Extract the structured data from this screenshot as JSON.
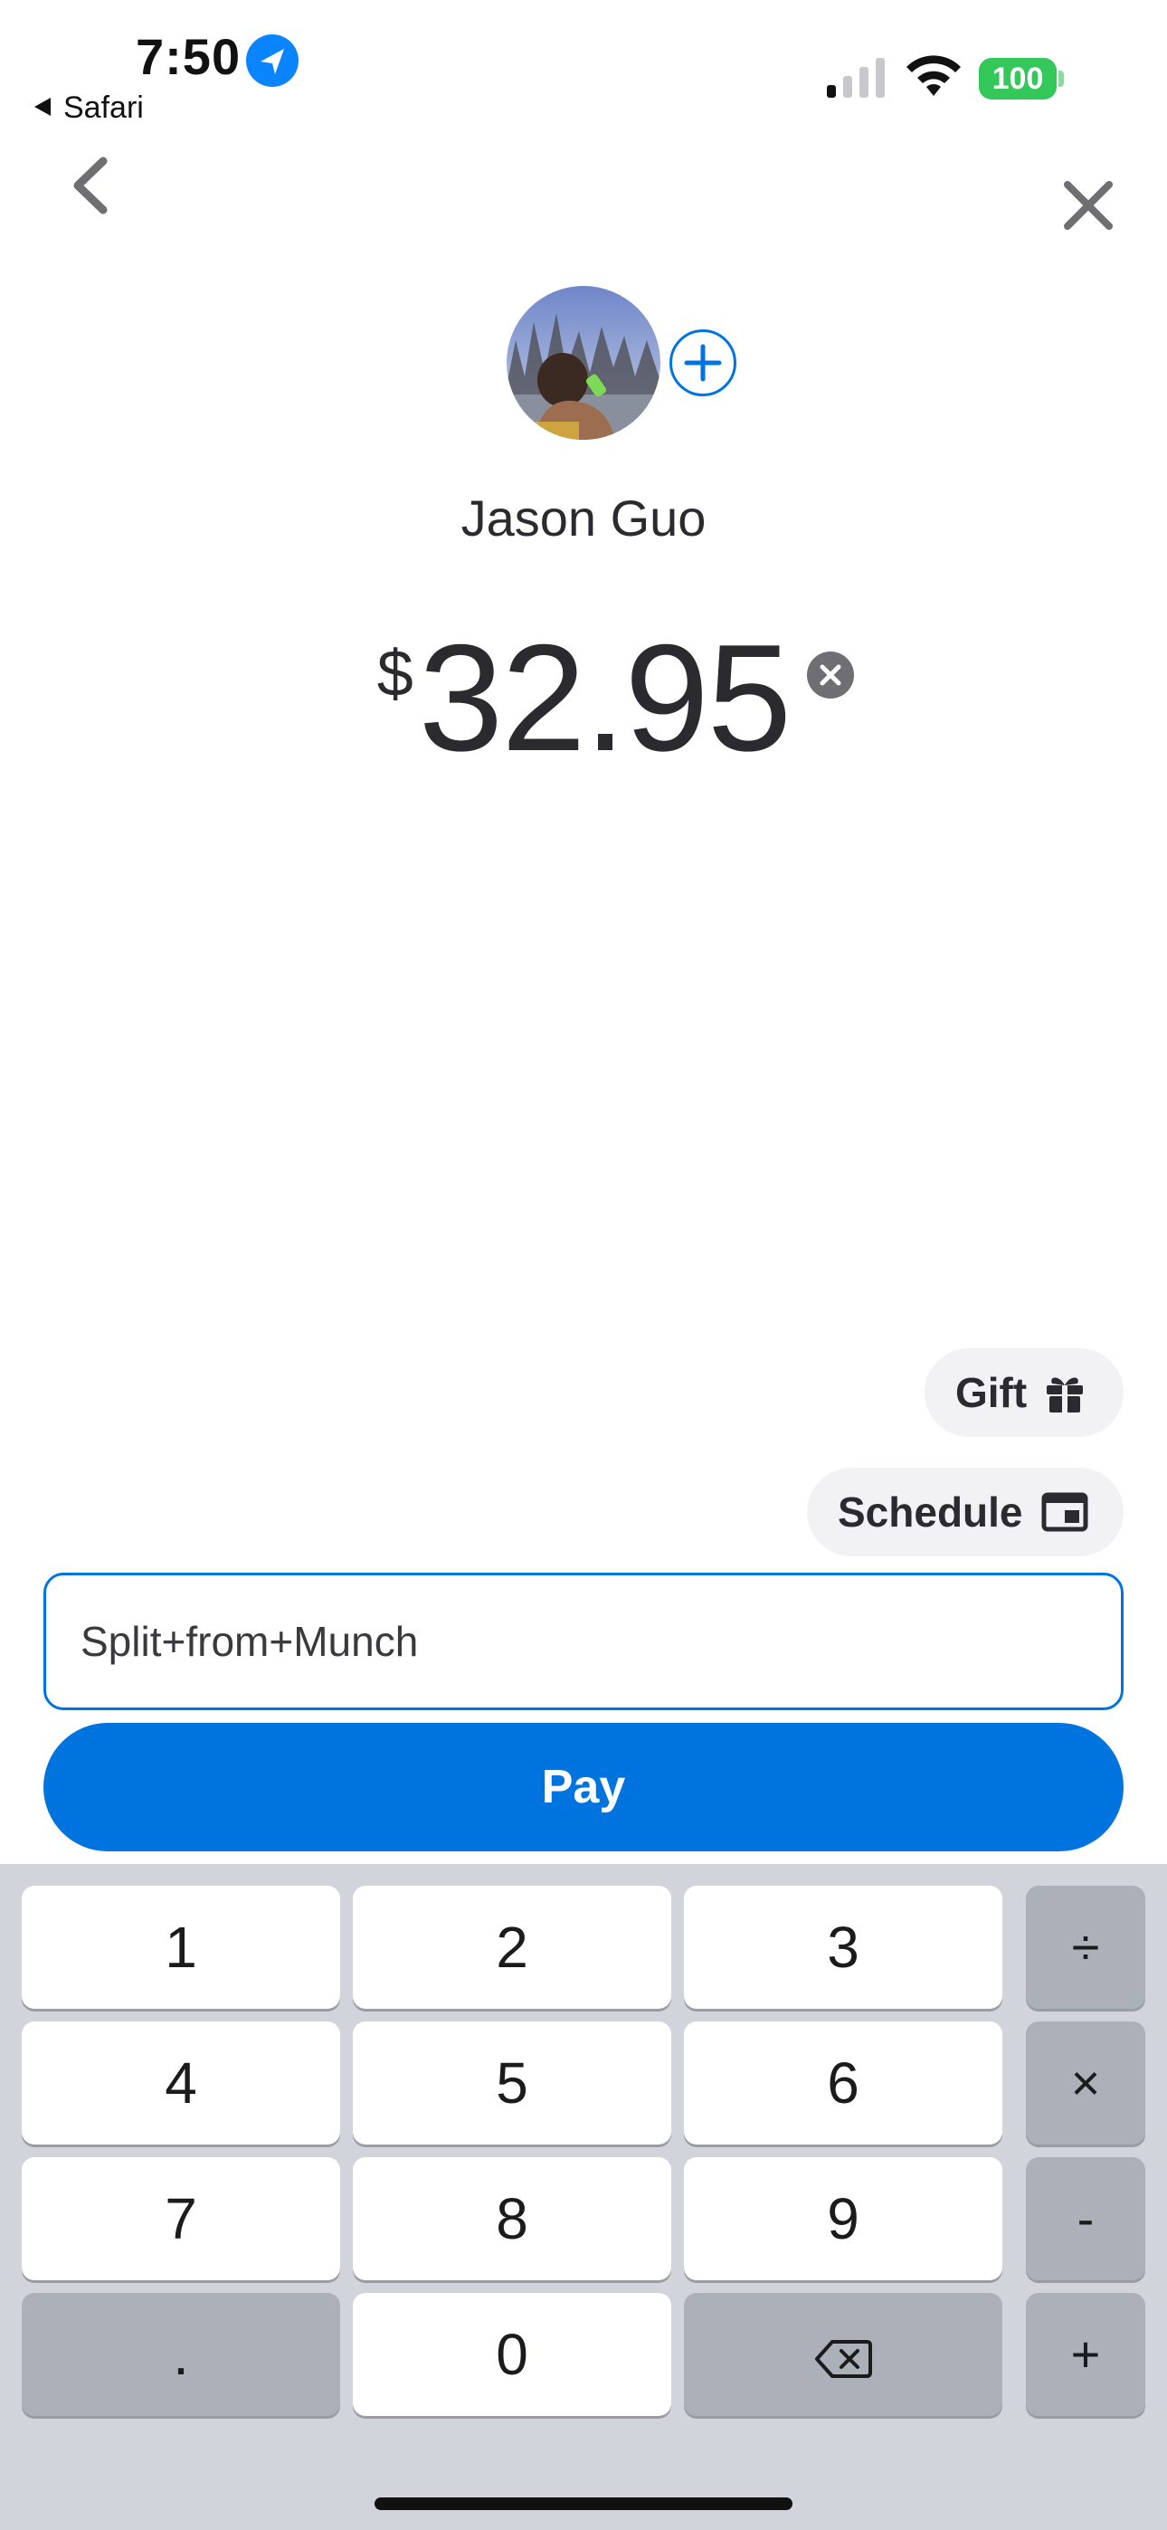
{
  "status_bar": {
    "time": "7:50",
    "back_app": "Safari",
    "battery": "100",
    "colors": {
      "battery": "#34c759",
      "location": "#0a84ff"
    }
  },
  "nav": {
    "back_icon": "chevron-left-icon",
    "close_icon": "close-icon"
  },
  "recipient": {
    "name": "Jason Guo"
  },
  "amount": {
    "currency": "$",
    "value": "32.95"
  },
  "chips": {
    "gift": "Gift",
    "schedule": "Schedule"
  },
  "note": {
    "value": "Split+from+Munch"
  },
  "pay": {
    "label": "Pay",
    "color": "#0074de"
  },
  "keypad": {
    "keys": [
      "1",
      "2",
      "3",
      "÷",
      "4",
      "5",
      "6",
      "×",
      "7",
      "8",
      "9",
      "-",
      ".",
      "0",
      "⌫",
      "+"
    ]
  }
}
